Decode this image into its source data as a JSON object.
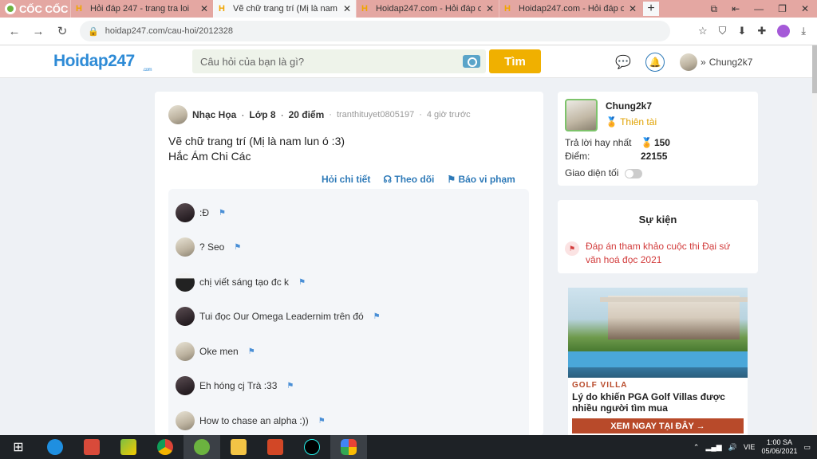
{
  "browser": {
    "brand": "CỐC CỐC",
    "tabs": [
      {
        "title": "Hỏi đáp 247 - trang tra loi",
        "active": false
      },
      {
        "title": "Vẽ chữ trang trí (Mị là nam lu",
        "active": true
      },
      {
        "title": "Hoidap247.com - Hỏi đáp on",
        "active": false
      },
      {
        "title": "Hoidap247.com - Hỏi đáp on",
        "active": false
      }
    ],
    "new_tab": "+",
    "url": "hoidap247.com/cau-hoi/2012328"
  },
  "header": {
    "logo": "Hoidap247",
    "logo_sub": ".com",
    "search_placeholder": "Câu hỏi của bạn là gì?",
    "search_button": "Tìm",
    "username": "Chung2k7"
  },
  "question": {
    "subject": "Nhạc Họa",
    "grade": "Lớp 8",
    "points": "20 điểm",
    "author": "tranthituyet0805197",
    "time": "4 giờ trước",
    "lines": [
      "Vẽ chữ trang trí (Mị là nam lun ó :3)",
      "Hắc Ám Chi Các"
    ],
    "actions": {
      "detail": "Hỏi chi tiết",
      "follow": "Theo dõi",
      "report": "Báo vi phạm"
    }
  },
  "comments": [
    {
      "text": ":Đ",
      "avatar": "dark"
    },
    {
      "text": "? Seo",
      "avatar": "light"
    },
    {
      "text": "chị viết sáng tạo đc k",
      "avatar": "girl"
    },
    {
      "text": "Tui đọc Our Omega Leadernim trên đó",
      "avatar": "dark"
    },
    {
      "text": "Oke men",
      "avatar": "light"
    },
    {
      "text": "Eh hóng cj Trà :33",
      "avatar": "dark"
    },
    {
      "text": "How to chase an alpha :))",
      "avatar": "light"
    }
  ],
  "profile": {
    "name": "Chung2k7",
    "rank": "Thiên tài",
    "best_answers_label": "Trả lời hay nhất",
    "best_answers": "150",
    "points_label": "Điểm:",
    "points": "22155",
    "dark_mode_label": "Giao diện tối"
  },
  "events": {
    "title": "Sự kiện",
    "item": "Đáp án tham khảo cuộc thi Đại sứ văn hoá đọc 2021"
  },
  "ad": {
    "tag": "GOLF VILLA",
    "text": "Lý do khiến PGA Golf Villas được nhiều người tìm mua",
    "button": "XEM NGAY TẠI ĐÂY →"
  },
  "taskbar": {
    "lang": "VIE",
    "time": "1:00 SA",
    "date": "05/06/2021"
  }
}
